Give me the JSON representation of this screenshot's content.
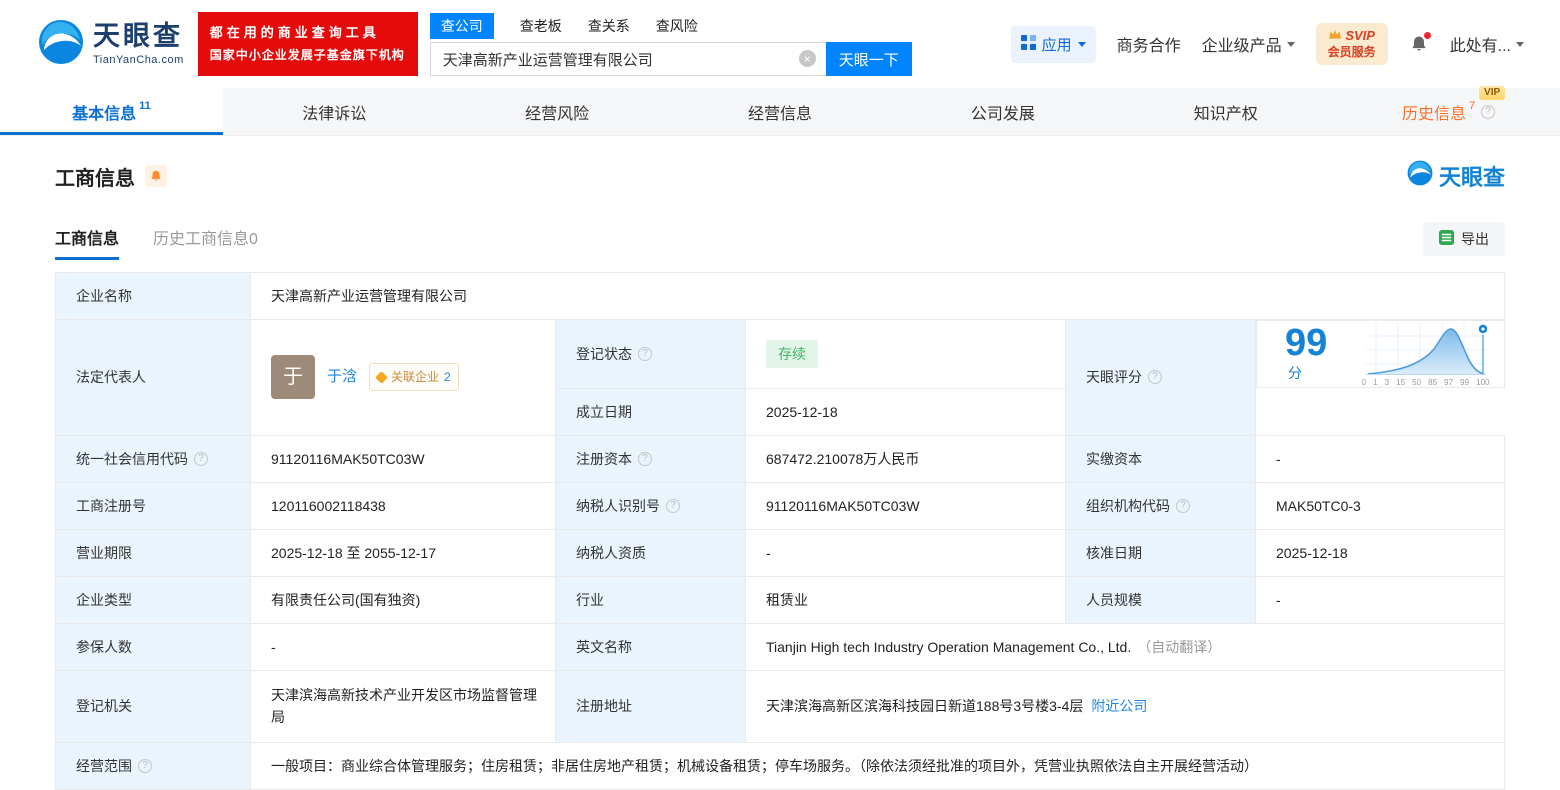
{
  "header": {
    "logo": {
      "cn": "天眼查",
      "en": "TianYanCha.com"
    },
    "promo": {
      "line1": "都在用的商业查询工具",
      "line2": "国家中小企业发展子基金旗下机构"
    },
    "search_tabs": [
      {
        "label": "查公司"
      },
      {
        "label": "查老板"
      },
      {
        "label": "查关系"
      },
      {
        "label": "查风险"
      }
    ],
    "search": {
      "value": "天津高新产业运营管理有限公司",
      "button": "天眼一下"
    },
    "right": {
      "apps": "应用",
      "biz_coop": "商务合作",
      "enterprise": "企业级产品",
      "svip_top": "SVIP",
      "svip_bottom": "会员服务",
      "account": "此处有..."
    }
  },
  "nav": {
    "tabs": [
      {
        "label": "基本信息",
        "count": "11"
      },
      {
        "label": "法律诉讼"
      },
      {
        "label": "经营风险"
      },
      {
        "label": "经营信息"
      },
      {
        "label": "公司发展"
      },
      {
        "label": "知识产权"
      },
      {
        "label": "历史信息",
        "count": "7"
      }
    ],
    "vip_badge": "VIP"
  },
  "section": {
    "title": "工商信息",
    "brand": "天眼查",
    "tabs": [
      {
        "label": "工商信息"
      },
      {
        "label": "历史工商信息0"
      }
    ],
    "export_label": "导出"
  },
  "fields": {
    "company_name": {
      "label": "企业名称",
      "value": "天津高新产业运营管理有限公司"
    },
    "legal_rep": {
      "label": "法定代表人",
      "avatar_char": "于",
      "name": "于浛",
      "related_label": "关联企业",
      "related_count": "2"
    },
    "reg_status": {
      "label": "登记状态",
      "value": "存续"
    },
    "est_date": {
      "label": "成立日期",
      "value": "2025-12-18"
    },
    "score": {
      "label": "天眼评分",
      "value": "99",
      "unit": "分",
      "axis": [
        "0",
        "1",
        "3",
        "15",
        "50",
        "85",
        "97",
        "99",
        "100"
      ]
    },
    "credit_code": {
      "label": "统一社会信用代码",
      "value": "91120116MAK50TC03W"
    },
    "reg_capital": {
      "label": "注册资本",
      "value": "687472.210078万人民币"
    },
    "paid_capital": {
      "label": "实缴资本",
      "value": "-"
    },
    "reg_number": {
      "label": "工商注册号",
      "value": "120116002118438"
    },
    "taxpayer_id": {
      "label": "纳税人识别号",
      "value": "91120116MAK50TC03W"
    },
    "org_code": {
      "label": "组织机构代码",
      "value": "MAK50TC0-3"
    },
    "term": {
      "label": "营业期限",
      "value": "2025-12-18 至 2055-12-17"
    },
    "taxpayer_quality": {
      "label": "纳税人资质",
      "value": "-"
    },
    "approval_date": {
      "label": "核准日期",
      "value": "2025-12-18"
    },
    "company_type": {
      "label": "企业类型",
      "value": "有限责任公司(国有独资)"
    },
    "industry": {
      "label": "行业",
      "value": "租赁业"
    },
    "staff": {
      "label": "人员规模",
      "value": "-"
    },
    "insured": {
      "label": "参保人数",
      "value": "-"
    },
    "english_name": {
      "label": "英文名称",
      "value": "Tianjin High tech Industry Operation Management Co., Ltd.",
      "note": "（自动翻译）"
    },
    "authority": {
      "label": "登记机关",
      "value": "天津滨海高新技术产业开发区市场监督管理局"
    },
    "address": {
      "label": "注册地址",
      "value": "天津滨海高新区滨海科技园日新道188号3号楼3-4层",
      "link": "附近公司"
    },
    "scope": {
      "label": "经营范围",
      "value": "一般项目：商业综合体管理服务；住房租赁；非居住房地产租赁；机械设备租赁；停车场服务。（除依法须经批准的项目外，凭营业执照依法自主开展经营活动）"
    }
  },
  "icons": {
    "question": "?",
    "close": "×"
  }
}
